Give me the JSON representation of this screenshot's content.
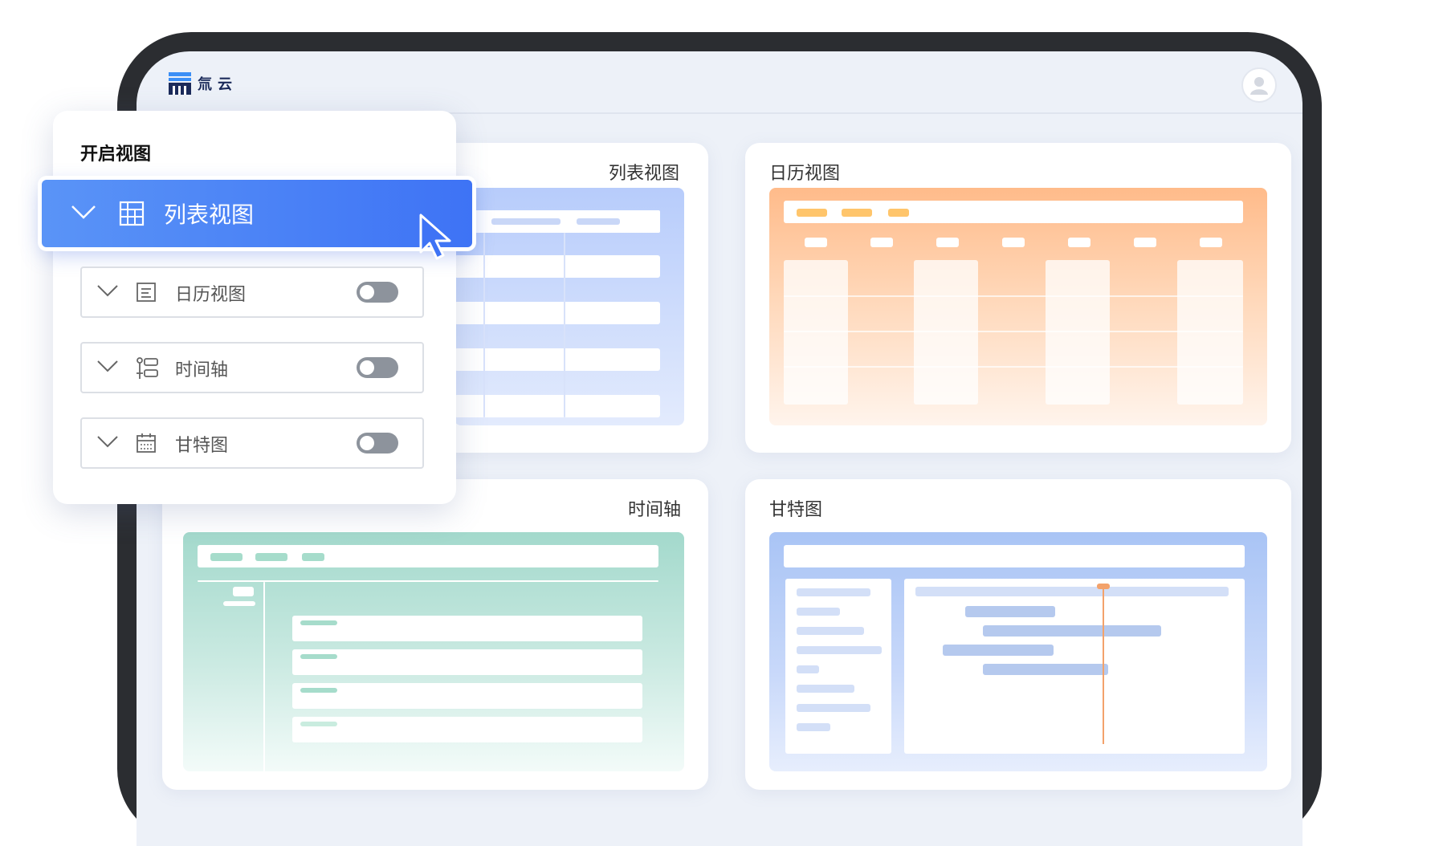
{
  "app": {
    "logo_text": "云",
    "logo_char": "氚"
  },
  "menu": {
    "title": "开启视图",
    "selected": {
      "label": "列表视图",
      "icon": "table-icon"
    },
    "options": [
      {
        "label": "日历视图",
        "icon": "document-icon",
        "enabled": false
      },
      {
        "label": "时间轴",
        "icon": "timeline-icon",
        "enabled": false
      },
      {
        "label": "甘特图",
        "icon": "calendar-icon",
        "enabled": false
      }
    ]
  },
  "cards": {
    "list": {
      "title": "列表视图"
    },
    "calendar": {
      "title": "日历视图"
    },
    "timeline": {
      "title": "时间轴"
    },
    "gantt": {
      "title": "甘特图"
    }
  },
  "colors": {
    "accent": "#3e73f5",
    "calendar": "#ffb37a",
    "timeline": "#a8dcd0",
    "gantt": "#a9c4f5"
  }
}
